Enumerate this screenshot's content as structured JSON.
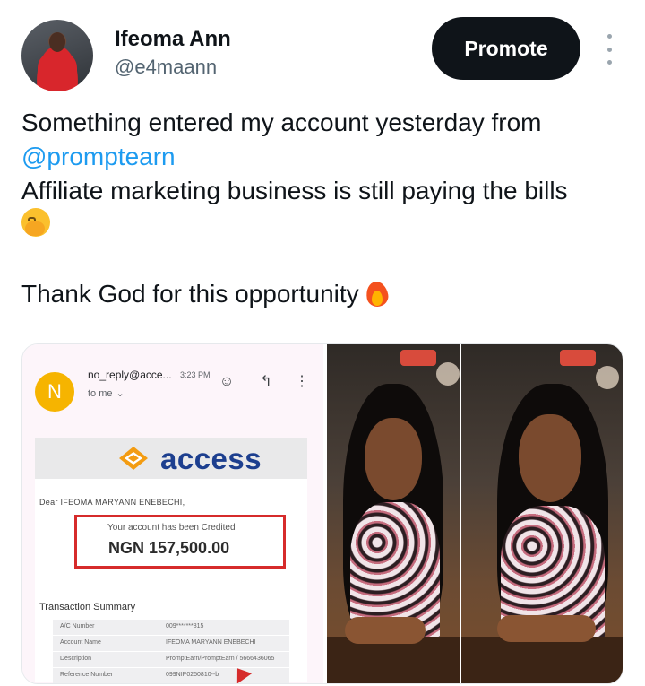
{
  "author": {
    "name": "Ifeoma Ann",
    "handle": "@e4maann"
  },
  "header": {
    "promote_label": "Promote"
  },
  "tweet": {
    "line1": "Something entered my account yesterday from",
    "mention": "@promptearn",
    "line3": "Affiliate marketing business is still paying the bills",
    "line5": "Thank God for this opportunity"
  },
  "email": {
    "avatar_letter": "N",
    "sender": "no_reply@acce...",
    "time": "3:23 PM",
    "recipient": "to me",
    "bank_name": "access",
    "greeting": "Dear IFEOMA MARYANN ENEBECHI,",
    "credit_label": "Your account has been Credited",
    "credit_amount": "NGN 157,500.00",
    "summary_title": "Transaction Summary",
    "summary_rows": [
      {
        "key": "A/C Number",
        "value": "009*******815"
      },
      {
        "key": "Account Name",
        "value": "IFEOMA MARYANN ENEBECHI"
      },
      {
        "key": "Description",
        "value": "PromptEarn/PromptEarn / 5666436065"
      },
      {
        "key": "Reference Number",
        "value": "099NIP0250810--b"
      }
    ]
  },
  "icons": {
    "more": "more-vertical-icon",
    "emoji1": "hand-over-mouth-emoji",
    "emoji2": "fire-emoji"
  },
  "colors": {
    "mention": "#1d9bf0",
    "promote_bg": "#0f1419",
    "access_blue": "#1d3f8f",
    "highlight_red": "#d62b2b"
  }
}
